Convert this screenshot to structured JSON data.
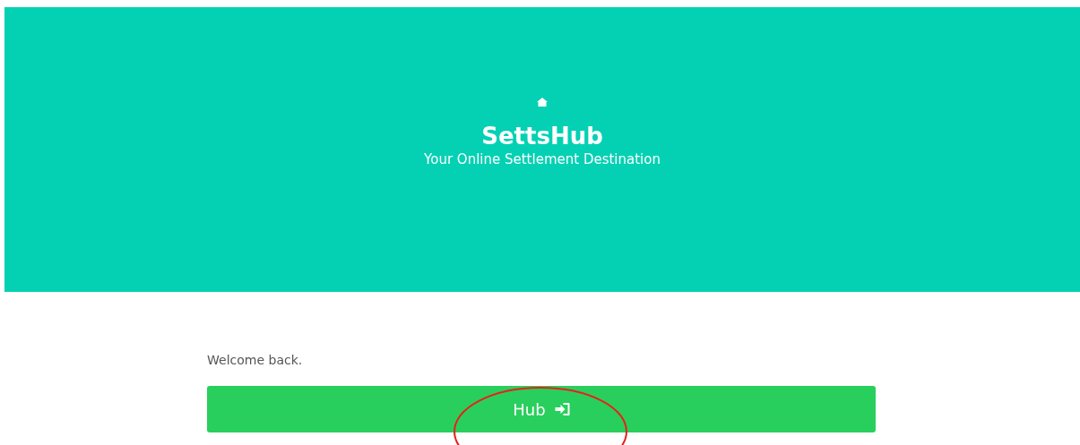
{
  "header": {
    "title": "SettsHub",
    "tagline": "Your Online Settlement Destination"
  },
  "welcome": "Welcome back.",
  "hub_button": {
    "label": "Hub"
  },
  "annotation": {
    "kind": "ellipse",
    "color": "#e8201c"
  }
}
